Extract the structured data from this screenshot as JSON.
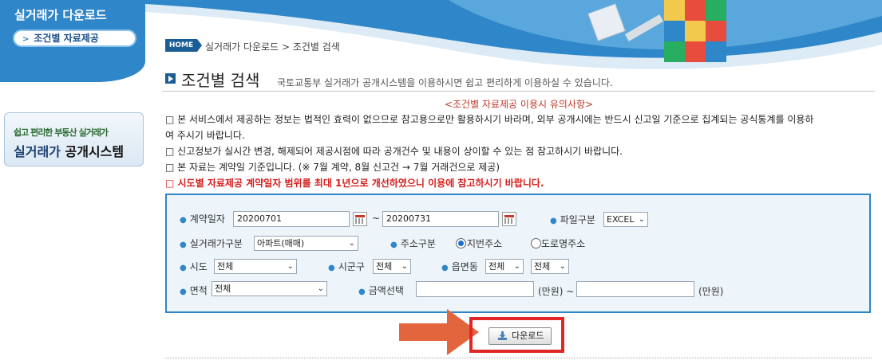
{
  "sidebar": {
    "title": "실거래가 다운로드",
    "active_item": "조건별 자료제공",
    "banner_line1": "쉽고 편리한 부동산 실거래가",
    "banner_line2_a": "실거래가",
    "banner_line2_b": "공개시스템"
  },
  "breadcrumb": {
    "home": "HOME",
    "path": "실거래가 다운로드 > 조건별 검색"
  },
  "page": {
    "title": "조건별 검색",
    "subtitle": "국토교통부 실거래가 공개시스템을 이용하시면 쉽고 편리하게 이용하실 수 있습니다."
  },
  "notice": {
    "header": "<조건별 자료제공 이용시 유의사항>",
    "lines": [
      "□ 본 서비스에서 제공하는 정보는 법적인 효력이 없으므로 참고용으로만 활용하시기 바라며, 외부 공개시에는 반드시 신고일 기준으로 집계되는 공식통계를 이용하",
      "여 주시기 바랍니다.",
      "□ 신고정보가 실시간 변경, 해제되어 제공시점에 따라 공개건수 및 내용이 상이할 수 있는 점 참고하시기 바랍니다.",
      "□ 본 자료는 계약일 기준입니다. (※ 7월 계약, 8월 신고건 → 7월 거래건으로 제공)",
      "□ 시도별 자료제공 계약일자 범위를 최대 1년으로 개선하였으니 이용에 참고하시기 바랍니다."
    ]
  },
  "form": {
    "contract_date_label": "계약일자",
    "date_from": "20200701",
    "date_sep": "~",
    "date_to": "20200731",
    "file_type_label": "파일구분",
    "file_type_value": "EXCEL",
    "deal_type_label": "실거래가구분",
    "deal_type_value": "아파트(매매)",
    "address_type_label": "주소구분",
    "address_opt1": "지번주소",
    "address_opt2": "도로명주소",
    "sido_label": "시도",
    "sido_value": "전체",
    "sigungu_label": "시군구",
    "sigungu_value": "전체",
    "eupmyeondong_label": "읍면동",
    "eupmyeondong_value": "전체",
    "eupmyeondong_value2": "전체",
    "area_label": "면적",
    "area_value": "전체",
    "amount_label": "금액선택",
    "amount_unit1": "(만원) ~",
    "amount_unit2": "(만원)"
  },
  "download": {
    "label": "다운로드"
  },
  "colors": {
    "primary_blue": "#2f86c8",
    "dark_blue": "#1b5e96",
    "highlight_red": "#e02727",
    "arrow_orange": "#e2653d"
  }
}
